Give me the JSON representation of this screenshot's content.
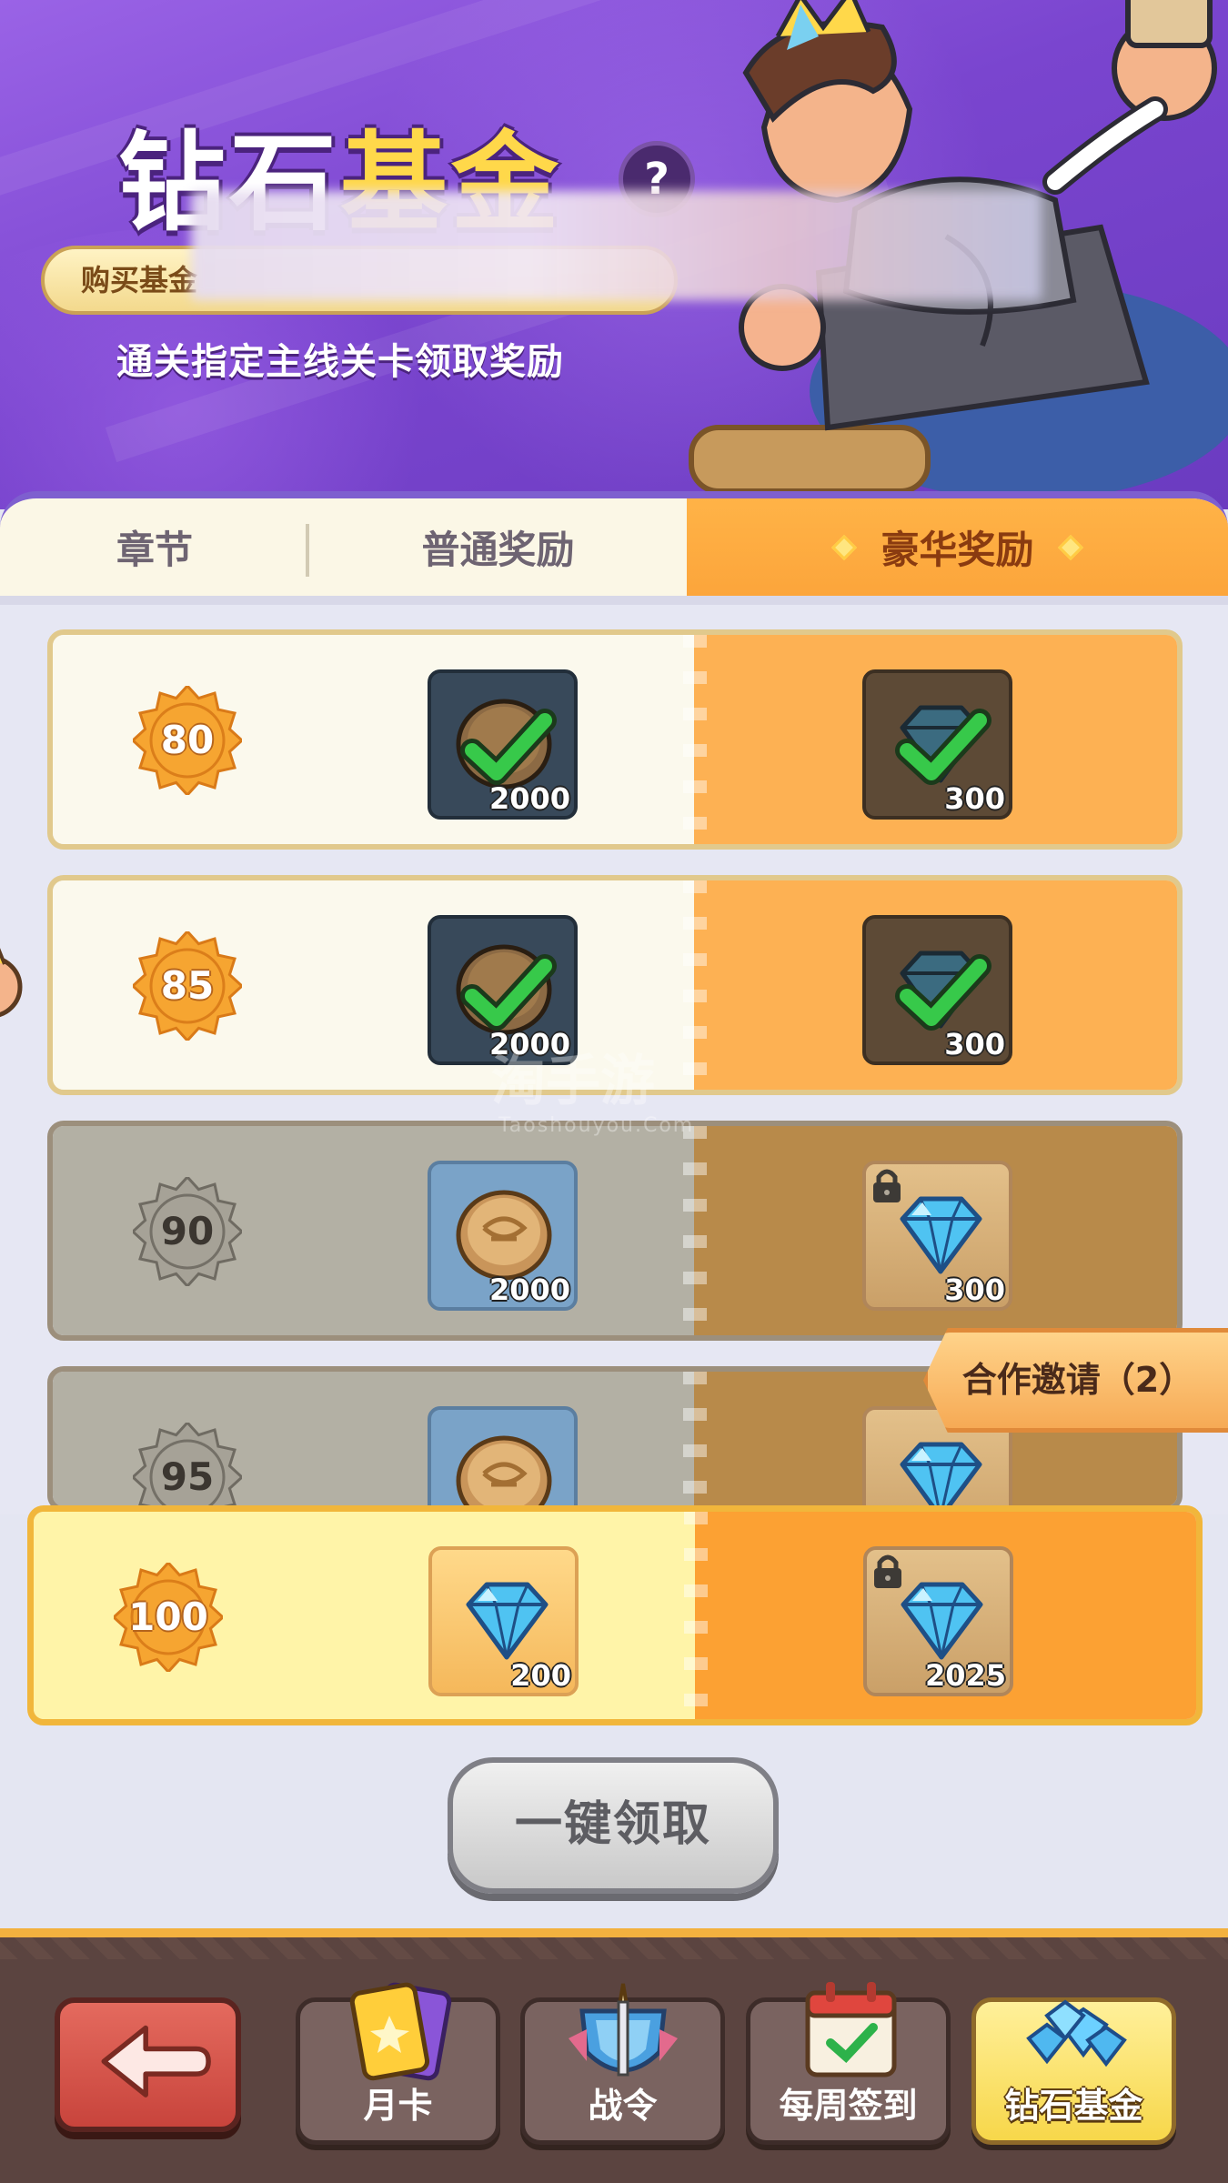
{
  "header": {
    "title_part1": "钻石",
    "title_part2": "基金",
    "help_symbol": "?",
    "buy_pill_label": "购买基金",
    "subtitle": "通关指定主线关卡领取奖励"
  },
  "tabs": [
    {
      "label": "章节"
    },
    {
      "label": "普通奖励"
    },
    {
      "label": "豪华奖励",
      "selected": true
    }
  ],
  "rows": [
    {
      "chapter": "80",
      "normal": {
        "item": "coin",
        "qty": "2000",
        "state": "claimed"
      },
      "deluxe": {
        "item": "gem",
        "qty": "300",
        "state": "claimed"
      }
    },
    {
      "chapter": "85",
      "normal": {
        "item": "coin",
        "qty": "2000",
        "state": "claimed"
      },
      "deluxe": {
        "item": "gem",
        "qty": "300",
        "state": "claimed"
      }
    },
    {
      "chapter": "90",
      "normal": {
        "item": "coin",
        "qty": "2000",
        "state": "locked"
      },
      "deluxe": {
        "item": "gem",
        "qty": "300",
        "state": "locked"
      }
    },
    {
      "chapter": "95",
      "normal": {
        "item": "coin",
        "qty": "",
        "state": "locked"
      },
      "deluxe": {
        "item": "gem",
        "qty": "",
        "state": "locked"
      }
    },
    {
      "chapter": "100",
      "normal": {
        "item": "gem",
        "qty": "200",
        "state": "available"
      },
      "deluxe": {
        "item": "gem",
        "qty": "2025",
        "state": "locked"
      }
    }
  ],
  "invite": {
    "label": "合作邀请（2）"
  },
  "claim_all": {
    "label": "一键领取"
  },
  "watermark": {
    "brand": "淘手游",
    "url": "Taoshouyou.Com"
  },
  "bottom_nav": {
    "back_icon": "back-arrow-icon",
    "items": [
      {
        "label": "月卡",
        "icon": "card-icon"
      },
      {
        "label": "战令",
        "icon": "sword-shield-icon"
      },
      {
        "label": "每周签到",
        "icon": "calendar-check-icon"
      },
      {
        "label": "钻石基金",
        "icon": "diamond-pile-icon",
        "active": true
      }
    ]
  },
  "colors": {
    "banner_purple": "#7a45cf",
    "deluxe_orange": "#fca53b",
    "title_yellow": "#ffd84a",
    "nav_brown": "#5b4440"
  }
}
